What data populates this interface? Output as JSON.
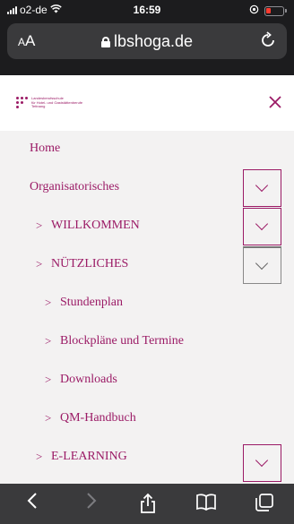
{
  "status_bar": {
    "carrier": "o2-de",
    "time": "16:59"
  },
  "address_bar": {
    "aa_label_small": "A",
    "aa_label_large": "A",
    "url": "lbshoga.de"
  },
  "site": {
    "logo_lines": [
      "Landesberufsschule",
      "für Hotel- und Gaststättenberufe",
      "Tettnang"
    ]
  },
  "menu": {
    "items": [
      {
        "label": "Home",
        "chevron": ""
      },
      {
        "label": "Organisatorisches",
        "chevron": ""
      },
      {
        "label": "WILLKOMMEN",
        "chevron": ">"
      },
      {
        "label": "NÜTZLICHES",
        "chevron": ">"
      },
      {
        "label": "Stundenplan",
        "chevron": ">"
      },
      {
        "label": "Blockpläne und Termine",
        "chevron": ">"
      },
      {
        "label": "Downloads",
        "chevron": ">"
      },
      {
        "label": "QM-Handbuch",
        "chevron": ">"
      },
      {
        "label": "E-LEARNING",
        "chevron": ">"
      }
    ]
  },
  "colors": {
    "accent": "#9b1b66",
    "menu_bg": "#f3f2f2",
    "toolbar_bg": "#3a3a3c"
  },
  "icons": {
    "toolbar": [
      "back-chevron-icon",
      "forward-chevron-icon",
      "share-icon",
      "bookmarks-icon",
      "tabs-icon"
    ]
  }
}
